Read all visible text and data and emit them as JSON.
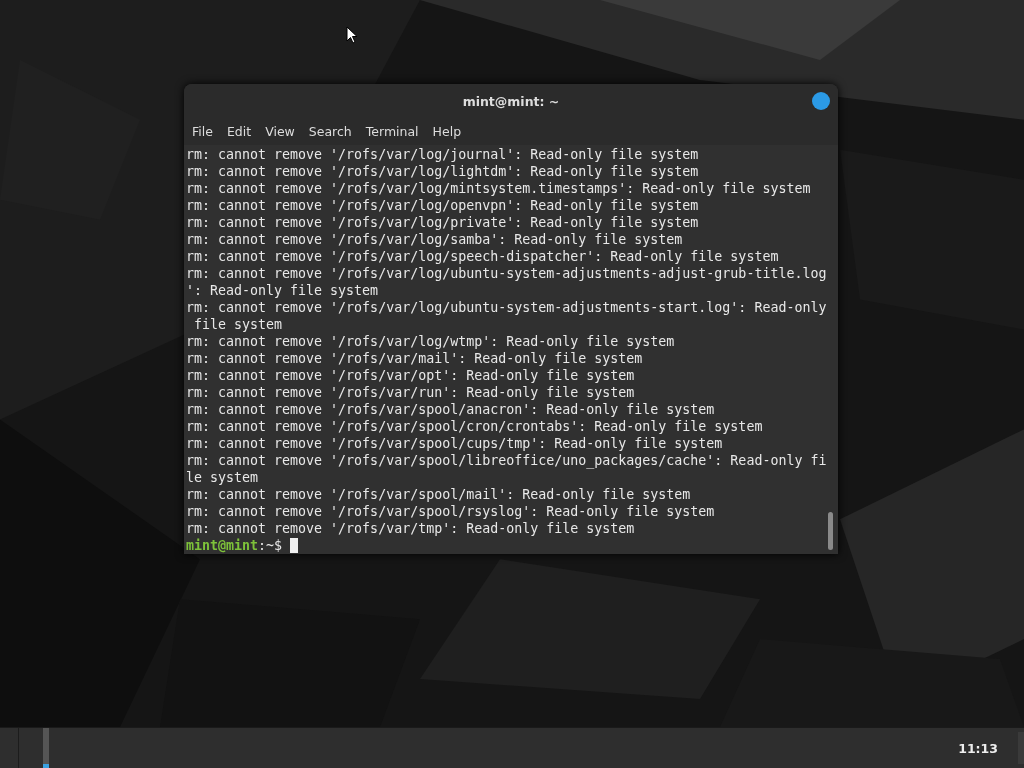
{
  "window": {
    "title": "mint@mint: ~"
  },
  "menu": [
    "File",
    "Edit",
    "View",
    "Search",
    "Terminal",
    "Help"
  ],
  "terminal": {
    "lines": [
      "rm: cannot remove '/rofs/var/log/journal': Read-only file system",
      "rm: cannot remove '/rofs/var/log/lightdm': Read-only file system",
      "rm: cannot remove '/rofs/var/log/mintsystem.timestamps': Read-only file system",
      "rm: cannot remove '/rofs/var/log/openvpn': Read-only file system",
      "rm: cannot remove '/rofs/var/log/private': Read-only file system",
      "rm: cannot remove '/rofs/var/log/samba': Read-only file system",
      "rm: cannot remove '/rofs/var/log/speech-dispatcher': Read-only file system",
      "rm: cannot remove '/rofs/var/log/ubuntu-system-adjustments-adjust-grub-title.log",
      "': Read-only file system",
      "rm: cannot remove '/rofs/var/log/ubuntu-system-adjustments-start.log': Read-only",
      " file system",
      "rm: cannot remove '/rofs/var/log/wtmp': Read-only file system",
      "rm: cannot remove '/rofs/var/mail': Read-only file system",
      "rm: cannot remove '/rofs/var/opt': Read-only file system",
      "rm: cannot remove '/rofs/var/run': Read-only file system",
      "rm: cannot remove '/rofs/var/spool/anacron': Read-only file system",
      "rm: cannot remove '/rofs/var/spool/cron/crontabs': Read-only file system",
      "rm: cannot remove '/rofs/var/spool/cups/tmp': Read-only file system",
      "rm: cannot remove '/rofs/var/spool/libreoffice/uno_packages/cache': Read-only fi",
      "le system",
      "rm: cannot remove '/rofs/var/spool/mail': Read-only file system",
      "rm: cannot remove '/rofs/var/spool/rsyslog': Read-only file system",
      "rm: cannot remove '/rofs/var/tmp': Read-only file system"
    ],
    "prompt": {
      "user_host": "mint@mint",
      "path": ":~$"
    }
  },
  "taskbar": {
    "clock": "11:13"
  }
}
